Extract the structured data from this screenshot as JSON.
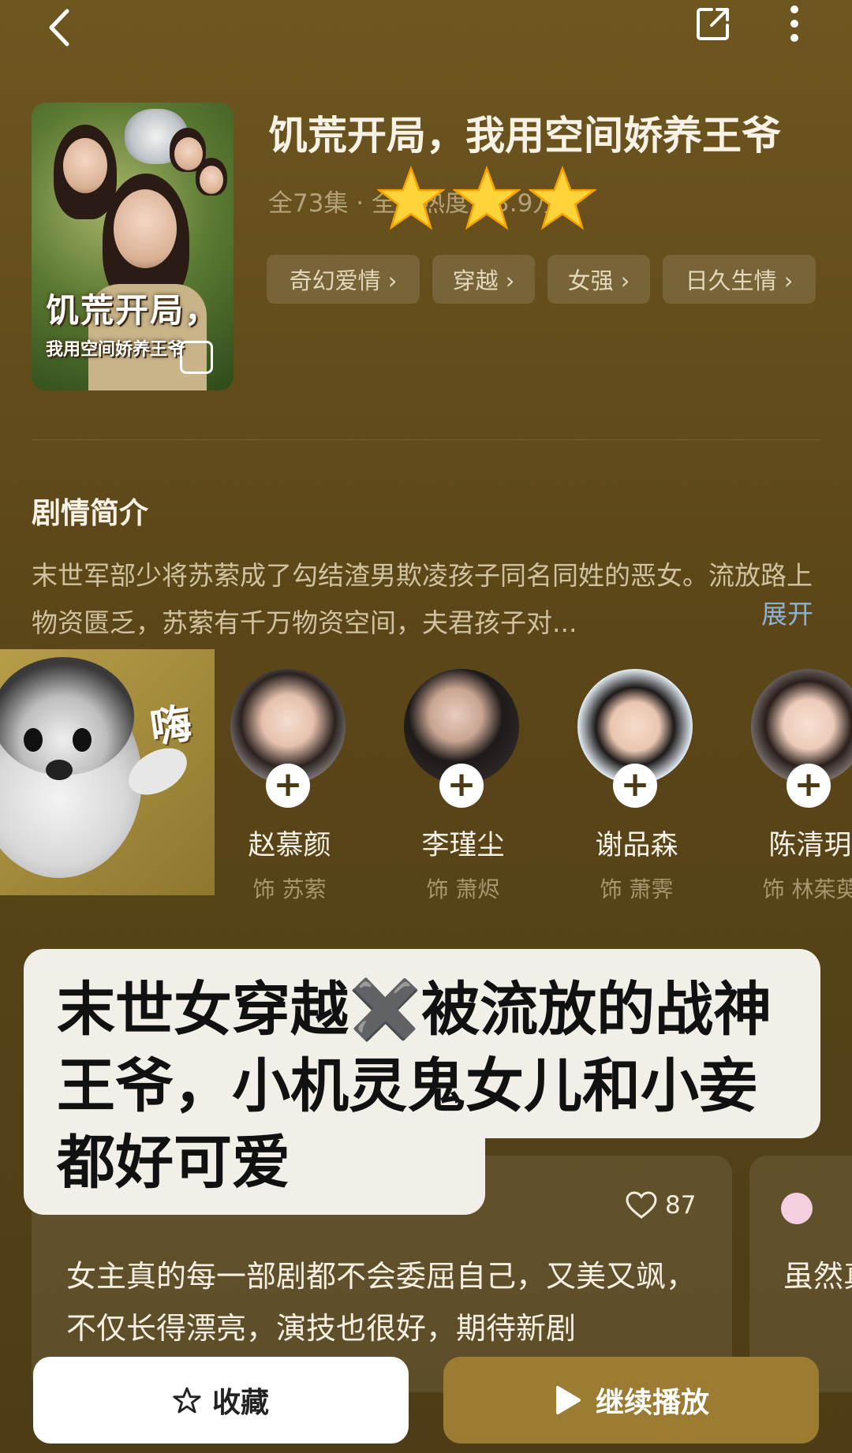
{
  "drama": {
    "title": "饥荒开局，我用空间娇养王爷",
    "meta": "全73集 · 全网热度值3.9万",
    "tags": [
      "奇幻爱情 ›",
      "穿越 ›",
      "女强 ›",
      "日久生情 ›"
    ],
    "poster_title_line1": "饥荒开局，",
    "poster_title_line2": "我用空间娇养王爷"
  },
  "synopsis": {
    "heading": "剧情简介",
    "text": "末世军部少将苏萦成了勾结渣男欺凌孩子同名同姓的恶女。流放路上物资匮乏，苏萦有千万物资空间，夫君孩子对...",
    "expand_label": "展开"
  },
  "sticker": {
    "text": "嗨"
  },
  "cast": [
    {
      "name": "赵慕颜",
      "role": "饰 苏萦"
    },
    {
      "name": "李瑾尘",
      "role": "饰 萧烬"
    },
    {
      "name": "谢品森",
      "role": "饰 萧霁"
    },
    {
      "name": "陈清玥",
      "role": "饰 林茱萸"
    }
  ],
  "caption": "末世女穿越✖️被流放的战神王爷，小机灵鬼女儿和小妾都好可爱",
  "comments": {
    "likes": "87",
    "text1": "女主真的每一部剧都不会委屈自己，又美又飒，不仅长得漂亮，演技也很好，期待新剧",
    "text2": "虽然真不"
  },
  "actions": {
    "collect_label": "收藏",
    "play_label": "继续播放"
  },
  "colors": {
    "accent": "#9c7b32",
    "link": "#8eb2d6"
  }
}
